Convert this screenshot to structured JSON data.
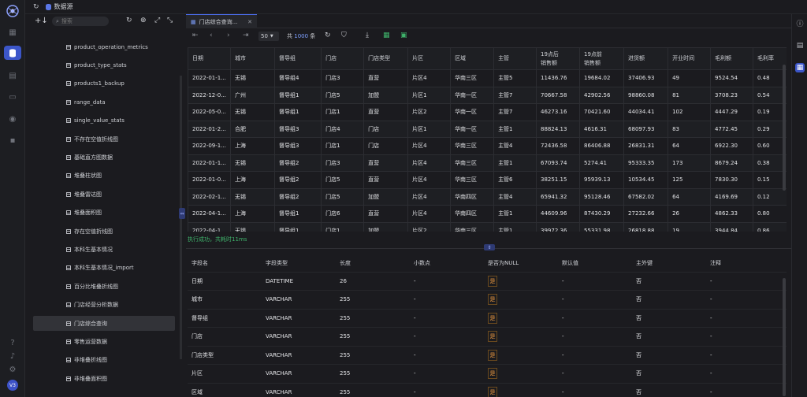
{
  "topbar": {
    "title": "数据源"
  },
  "tree": {
    "search_placeholder": "搜索",
    "items": [
      "product_operation_metrics",
      "product_type_stats",
      "products1_backup",
      "range_data",
      "single_value_stats",
      "不存在空值折线图",
      "基础直方图数据",
      "堆叠柱状图",
      "堆叠雷达图",
      "堆叠面积图",
      "存在空值折线图",
      "本科生基本情况",
      "本科生基本情况_import",
      "百分比堆叠折线图",
      "门店经营分析数据",
      "门店综合查询",
      "零售运营数据",
      "非堆叠折线图",
      "非堆叠面积图"
    ],
    "selected_index": 15
  },
  "tab": {
    "label": "门店综合查询..."
  },
  "pager": {
    "page_size": "50",
    "total_prefix": "共",
    "total": "1000",
    "total_suffix": "条"
  },
  "grid": {
    "columns": [
      "日期",
      "城市",
      "督导组",
      "门店",
      "门店类型",
      "片区",
      "区域",
      "主管",
      "19点后\n销售额",
      "19点前\n销售额",
      "进货额",
      "开业时间",
      "毛利额",
      "毛利率"
    ],
    "rows": [
      [
        "2022-01-1...",
        "无锡",
        "督导组4",
        "门店3",
        "直营",
        "片区4",
        "华南三区",
        "主管5",
        "11436.76",
        "19684.02",
        "37406.93",
        "49",
        "9524.54",
        "0.48"
      ],
      [
        "2022-12-0...",
        "广州",
        "督导组1",
        "门店5",
        "加盟",
        "片区1",
        "华南一区",
        "主管7",
        "70667.58",
        "42902.56",
        "98860.08",
        "81",
        "3708.23",
        "0.54"
      ],
      [
        "2022-05-0...",
        "无锡",
        "督导组1",
        "门店1",
        "直营",
        "片区2",
        "华南一区",
        "主管7",
        "46273.16",
        "70421.60",
        "44034.41",
        "102",
        "4447.29",
        "0.19"
      ],
      [
        "2022-01-2...",
        "合肥",
        "督导组3",
        "门店4",
        "门店",
        "片区1",
        "华南一区",
        "主管1",
        "88824.13",
        "4616.31",
        "68097.93",
        "83",
        "4772.45",
        "0.29"
      ],
      [
        "2022-09-1...",
        "上海",
        "督导组3",
        "门店1",
        "门店",
        "片区4",
        "华南三区",
        "主管4",
        "72436.58",
        "86406.88",
        "26831.31",
        "64",
        "6922.30",
        "0.60"
      ],
      [
        "2022-01-1...",
        "无锡",
        "督导组2",
        "门店3",
        "直营",
        "片区4",
        "华南三区",
        "主管1",
        "67093.74",
        "5274.41",
        "95333.35",
        "173",
        "8679.24",
        "0.38"
      ],
      [
        "2022-01-0...",
        "上海",
        "督导组2",
        "门店5",
        "直营",
        "片区4",
        "华南三区",
        "主管6",
        "38251.15",
        "95939.13",
        "10534.45",
        "125",
        "7830.30",
        "0.15"
      ],
      [
        "2022-02-1...",
        "无锡",
        "督导组2",
        "门店5",
        "加盟",
        "片区4",
        "华南四区",
        "主管4",
        "65941.32",
        "95128.46",
        "67582.02",
        "64",
        "4169.69",
        "0.12"
      ],
      [
        "2022-04-1...",
        "上海",
        "督导组1",
        "门店6",
        "直营",
        "片区4",
        "华南四区",
        "主管1",
        "44609.96",
        "87430.29",
        "27232.66",
        "26",
        "4862.33",
        "0.80"
      ],
      [
        "2022-04-1...",
        "无锡",
        "督导组1",
        "门店1",
        "加盟",
        "片区2",
        "华南三区",
        "主管1",
        "39972.36",
        "55331.98",
        "26818.88",
        "19",
        "3944.84",
        "0.86"
      ]
    ]
  },
  "status": "执行成功，共耗时11ms",
  "meta": {
    "columns": [
      "字段名",
      "字段类型",
      "长度",
      "小数点",
      "是否为NULL",
      "默认值",
      "主外键",
      "注释"
    ],
    "rows": [
      [
        "日期",
        "DATETIME",
        "26",
        "-",
        "是",
        "-",
        "否",
        "-"
      ],
      [
        "城市",
        "VARCHAR",
        "255",
        "-",
        "是",
        "-",
        "否",
        "-"
      ],
      [
        "督导组",
        "VARCHAR",
        "255",
        "-",
        "是",
        "-",
        "否",
        "-"
      ],
      [
        "门店",
        "VARCHAR",
        "255",
        "-",
        "是",
        "-",
        "否",
        "-"
      ],
      [
        "门店类型",
        "VARCHAR",
        "255",
        "-",
        "是",
        "-",
        "否",
        "-"
      ],
      [
        "片区",
        "VARCHAR",
        "255",
        "-",
        "是",
        "-",
        "否",
        "-"
      ],
      [
        "区域",
        "VARCHAR",
        "255",
        "-",
        "是",
        "-",
        "否",
        "-"
      ]
    ]
  },
  "user": {
    "avatar": "V3"
  },
  "colors": {
    "accent": "#3c56c9",
    "success": "#3fb36b",
    "null_badge": "#e6963f"
  }
}
